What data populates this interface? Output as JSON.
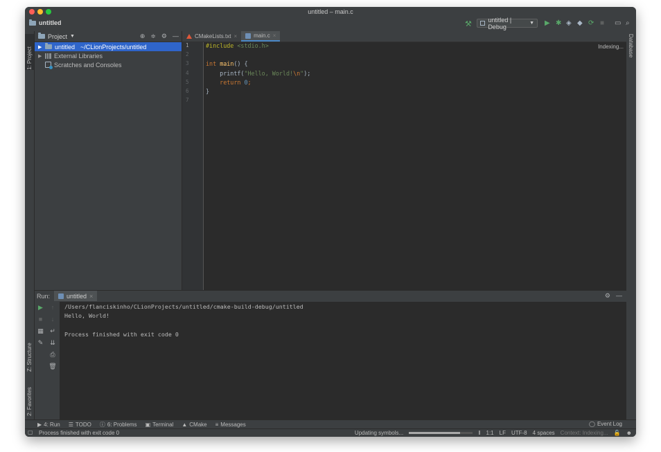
{
  "window": {
    "title": "untitled – main.c"
  },
  "navbar": {
    "project": "untitled",
    "run_config": "untitled | Debug"
  },
  "left_strip": {
    "project_tab": "1: Project",
    "structure_tab": "Z: Structure",
    "favorites_tab": "2: Favorites"
  },
  "right_strip": {
    "database_tab": "Database"
  },
  "project_panel": {
    "title": "Project",
    "tree": [
      {
        "label": "untitled",
        "path": "~/CLionProjects/untitled"
      },
      {
        "label": "External Libraries"
      },
      {
        "label": "Scratches and Consoles"
      }
    ]
  },
  "editor": {
    "tabs": [
      {
        "label": "CMakeLists.txt"
      },
      {
        "label": "main.c"
      }
    ],
    "status": "Indexing...",
    "line_numbers": [
      "1",
      "2",
      "3",
      "4",
      "5",
      "6",
      "7"
    ],
    "code": {
      "l1_pp": "#include",
      "l1_inc": "<stdio.h>",
      "l3_kw": "int",
      "l3_fn": "main",
      "l3_rest": "() {",
      "l4_call": "    printf(",
      "l4_str1": "\"Hello, World!",
      "l4_esc": "\\n",
      "l4_str2": "\"",
      "l4_end": ");",
      "l5_kw": "    return",
      "l5_num": "0",
      "l5_end": ";",
      "l6": "}"
    }
  },
  "run_panel": {
    "label": "Run:",
    "tab": "untitled",
    "output": [
      "/Users/flanciskinho/CLionProjects/untitled/cmake-build-debug/untitled",
      "Hello, World!",
      "",
      "Process finished with exit code 0"
    ]
  },
  "bottom_tabs": [
    "4: Run",
    "TODO",
    "6: Problems",
    "Terminal",
    "CMake",
    "Messages"
  ],
  "event_log": "Event Log",
  "status_bar": {
    "message": "Process finished with exit code 0",
    "task": "Updating symbols...",
    "progress": 0.8,
    "position": "1:1",
    "line_sep": "LF",
    "encoding": "UTF-8",
    "indent": "4 spaces",
    "context": "Context: Indexing..."
  }
}
